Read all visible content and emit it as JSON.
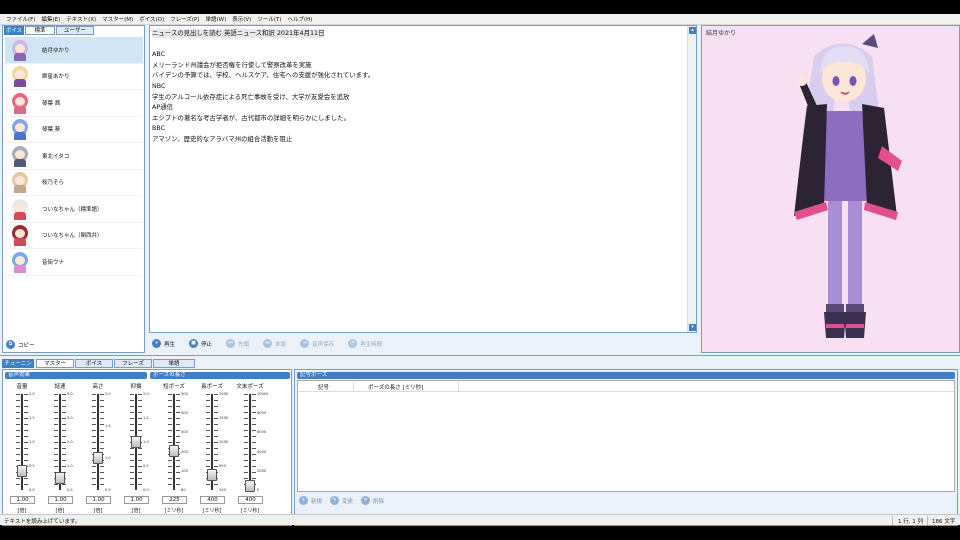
{
  "menu": [
    "ファイル(F)",
    "編集(E)",
    "テキスト(X)",
    "マスター(M)",
    "ボイス(O)",
    "フレーズ(P)",
    "単語(W)",
    "表示(V)",
    "ツール(T)",
    "ヘルプ(H)"
  ],
  "voice_panel": {
    "header_tab": "ボイス",
    "tabs": [
      "標準",
      "ユーザー"
    ],
    "voices": [
      {
        "name": "結月ゆかり",
        "hair": "#cbb8e6",
        "body": "#8a68b0",
        "selected": true
      },
      {
        "name": "紲星あかり",
        "hair": "#f0d9a0",
        "body": "#7a4e9a",
        "selected": false
      },
      {
        "name": "琴葉 茜",
        "hair": "#e26a7c",
        "body": "#d86a8e",
        "selected": false
      },
      {
        "name": "琴葉 葵",
        "hair": "#7fa6e6",
        "body": "#4e74c8",
        "selected": false
      },
      {
        "name": "東北イタコ",
        "hair": "#a8acb8",
        "body": "#565a78",
        "selected": false
      },
      {
        "name": "桜乃そら",
        "hair": "#e6c8a0",
        "body": "#c0a888",
        "selected": false
      },
      {
        "name": "ついなちゃん（標準語）",
        "hair": "#e8e8ee",
        "body": "#d44a5a",
        "selected": false
      },
      {
        "name": "ついなちゃん（関西弁）",
        "hair": "#a02a34",
        "body": "#d44a5a",
        "selected": false
      },
      {
        "name": "音街ウナ",
        "hair": "#7aa8ea",
        "body": "#e08ad0",
        "selected": false
      }
    ],
    "copy_label": "コピー"
  },
  "editor": {
    "lines": [
      "ニュースの見出しを読む 英語ニュース和訳 2021年4月11日",
      "",
      "ABC",
      "メリーランド州議会が拒否権を行使して警察改革を実施",
      "バイデンの予算では、学校、ヘルスケア、住宅への支援が強化されています。",
      "NBC",
      "学生のアルコール依存症による死亡事故を受け、大学が友愛会を追放",
      "AP通信",
      "エジプトの著名な考古学者が、古代都市の詳細を明らかにしました。",
      "BBC",
      "アマゾン、歴史的なアラバマ州の組合活動を阻止"
    ]
  },
  "playbar": [
    {
      "label": "再生",
      "icon": "pause-icon",
      "glyph": "⏸",
      "enabled": true
    },
    {
      "label": "停止",
      "icon": "stop-icon",
      "glyph": "■",
      "enabled": true
    },
    {
      "label": "先頭",
      "icon": "skip-start-icon",
      "glyph": "⏮",
      "enabled": false
    },
    {
      "label": "末尾",
      "icon": "skip-end-icon",
      "glyph": "⏭",
      "enabled": false
    },
    {
      "label": "音声保存",
      "icon": "save-audio-icon",
      "glyph": "⇥",
      "enabled": false
    },
    {
      "label": "再生時間",
      "icon": "timer-icon",
      "glyph": "◔",
      "enabled": false
    }
  ],
  "portrait": {
    "name": "結月ゆかり"
  },
  "tuning": {
    "tabs": [
      "チューニング",
      "マスター",
      "ボイス",
      "フレーズ",
      "単語"
    ],
    "voice_effects_label": "音声効果",
    "pause_length_label": "ポーズの長さ",
    "sliders": [
      {
        "label": "音量",
        "value": "1.00",
        "unit": "[倍]",
        "level": 0.2,
        "scale": [
          "2.0",
          "1.5",
          "1.0",
          "0.5",
          "0.0"
        ]
      },
      {
        "label": "話速",
        "value": "1.00",
        "unit": "[倍]",
        "level": 0.125,
        "scale": [
          "4.0",
          "3.0",
          "2.0",
          "1.0",
          "0.5"
        ]
      },
      {
        "label": "高さ",
        "value": "1.00",
        "unit": "[倍]",
        "level": 0.33,
        "scale": [
          "2.0",
          "1.5",
          "1.0",
          "0.5"
        ]
      },
      {
        "label": "抑揚",
        "value": "1.00",
        "unit": "[倍]",
        "level": 0.5,
        "scale": [
          "2.0",
          "1.5",
          "1.0",
          "0.5",
          "0.0"
        ]
      },
      {
        "label": "短ポーズ",
        "value": "225",
        "unit": "[ミリ秒]",
        "level": 0.41,
        "scale": [
          "500",
          "400",
          "300",
          "200",
          "100",
          "80"
        ]
      },
      {
        "label": "長ポーズ",
        "value": "400",
        "unit": "[ミリ秒]",
        "level": 0.16,
        "scale": [
          "2000",
          "1500",
          "1000",
          "500",
          "100"
        ]
      },
      {
        "label": "文末ポーズ",
        "value": "400",
        "unit": "[ミリ秒]",
        "level": 0.04,
        "scale": [
          "10000",
          "8000",
          "6000",
          "4000",
          "2000",
          "0"
        ]
      }
    ],
    "symbol_pause": {
      "title": "記号ポーズ",
      "columns": [
        "記号",
        "ポーズの長さ [ミリ秒]"
      ],
      "buttons": [
        {
          "label": "新規",
          "icon": "new-icon",
          "glyph": "+"
        },
        {
          "label": "変更",
          "icon": "edit-icon",
          "glyph": "✎"
        },
        {
          "label": "削除",
          "icon": "delete-icon",
          "glyph": "✕"
        }
      ]
    }
  },
  "status": {
    "message": "テキストを読み上げています。",
    "position": "1 行, 1 列",
    "char_count": "186 文字"
  },
  "colors": {
    "accent": "#3f7fc4",
    "portrait_bg": "#f8dff2"
  }
}
